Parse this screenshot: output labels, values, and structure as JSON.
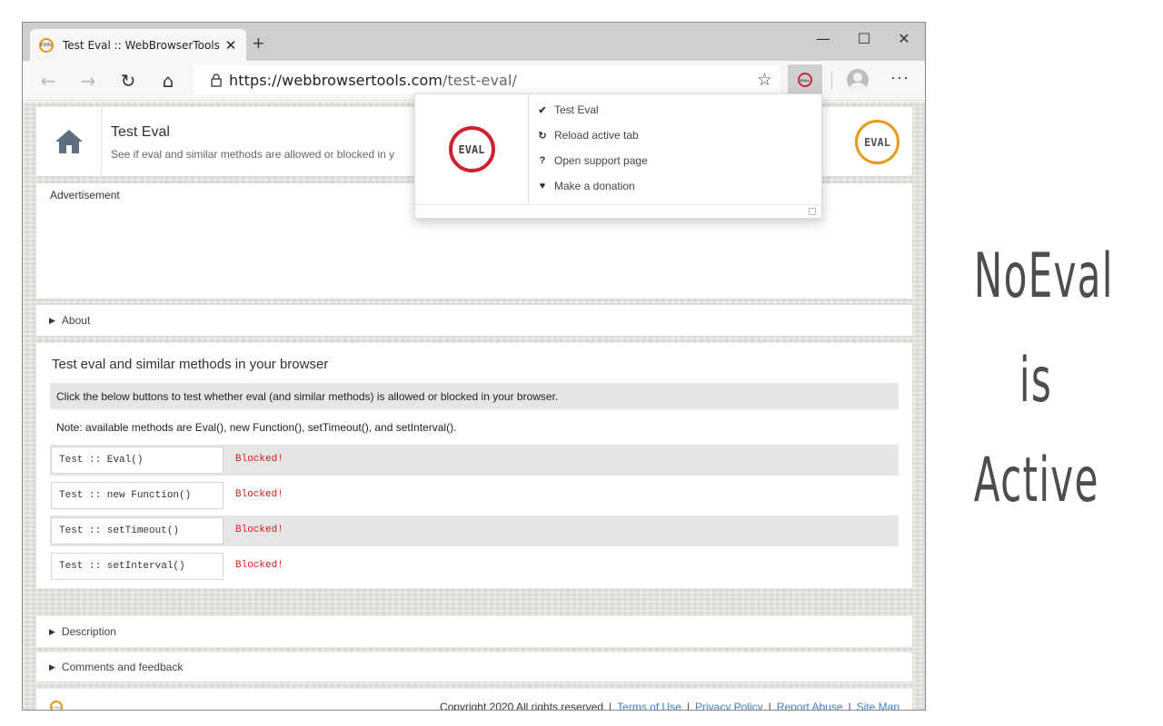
{
  "browser": {
    "tab_title": "Test Eval :: WebBrowserTools",
    "tab_close": "✕",
    "new_tab": "+",
    "window_controls": {
      "minimize": "—",
      "maximize": "☐",
      "close": "✕"
    },
    "nav": {
      "back": "←",
      "forward": "→",
      "reload": "↻",
      "home": "⌂"
    },
    "url_host": "https://webbrowsertools.com",
    "url_path": "/test-eval/",
    "star": "☆",
    "menu": "···"
  },
  "popup": {
    "logo_text": "EVAL",
    "items": [
      {
        "icon": "checkmark-icon",
        "glyph": "✔",
        "label": "Test Eval"
      },
      {
        "icon": "reload-icon",
        "glyph": "↻",
        "label": "Reload active tab"
      },
      {
        "icon": "question-icon",
        "glyph": "?",
        "label": "Open support page"
      },
      {
        "icon": "heart-icon",
        "glyph": "♥",
        "label": "Make a donation"
      }
    ]
  },
  "page": {
    "header": {
      "title": "Test Eval",
      "subtitle": "See if eval and similar methods are allowed or blocked in y",
      "logo_text": "EVAL"
    },
    "advertisement_label": "Advertisement",
    "sections": {
      "about": "About",
      "description": "Description",
      "comments": "Comments and feedback"
    },
    "main": {
      "title": "Test eval and similar methods in your browser",
      "info": "Click the below buttons to test whether eval (and similar methods) is allowed or blocked in your browser.",
      "note": "Note: available methods are Eval(), new Function(), setTimeout(), and setInterval().",
      "tests": [
        {
          "label": "Test :: Eval()",
          "result": "Blocked!"
        },
        {
          "label": "Test :: new Function()",
          "result": "Blocked!"
        },
        {
          "label": "Test :: setTimeout()",
          "result": "Blocked!"
        },
        {
          "label": "Test :: setInterval()",
          "result": "Blocked!"
        }
      ]
    },
    "footer": {
      "copyright": "Copyright 2020 All rights reserved",
      "links": [
        "Terms of Use",
        "Privacy Policy",
        "Report Abuse",
        "Site Map"
      ],
      "separator": "|"
    }
  },
  "caption": {
    "line1": "NoEval",
    "line2": "is",
    "line3": "Active"
  },
  "colors": {
    "accent_orange": "#e39b1a",
    "popup_red": "#cf2030",
    "blocked_red": "#e01818",
    "link_blue": "#3d7fc9"
  }
}
